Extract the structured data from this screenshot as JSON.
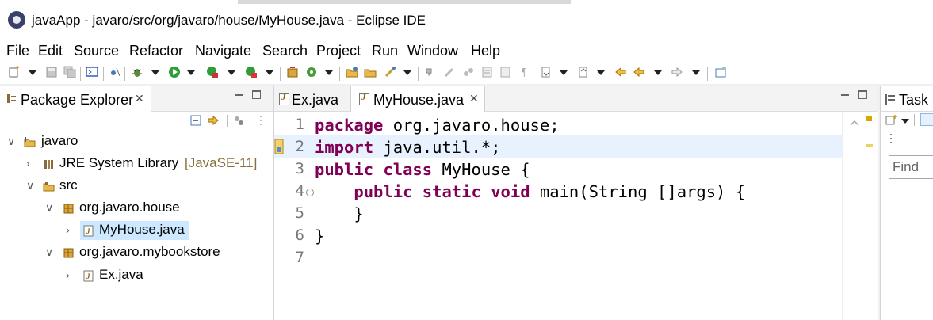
{
  "window": {
    "title": "javaApp - javaro/src/org/javaro/house/MyHouse.java - Eclipse IDE"
  },
  "menu": {
    "items": [
      "File",
      "Edit",
      "Source",
      "Refactor",
      "Navigate",
      "Search",
      "Project",
      "Run",
      "Window",
      "Help"
    ]
  },
  "toolbar": {
    "icons": [
      "new-icon",
      "save-icon",
      "save-all-icon",
      "terminal-icon",
      "skip-breakpoints-icon",
      "debug-icon",
      "run-icon",
      "coverage-icon",
      "external-tools-icon",
      "new-java-project-icon",
      "new-package-icon",
      "new-class-icon",
      "open-type-icon",
      "open-task-icon",
      "search-icon",
      "toggle-mark-occurrences-icon",
      "toggle-block-selection-icon",
      "show-whitespace-icon",
      "next-annotation-icon",
      "previous-annotation-icon",
      "last-edit-location-icon",
      "back-icon",
      "forward-icon",
      "pin-editor-icon"
    ]
  },
  "package_explorer": {
    "tab_label": "Package Explorer",
    "close_glyph": "✕",
    "tree": [
      {
        "label": "javaro",
        "decor": "",
        "level": 0,
        "twisty": "expanded",
        "icon": "project-icon"
      },
      {
        "label": "JRE System Library",
        "decor": "[JavaSE-11]",
        "level": 1,
        "twisty": "collapsed",
        "icon": "library-icon"
      },
      {
        "label": "src",
        "decor": "",
        "level": 1,
        "twisty": "expanded",
        "icon": "source-folder-icon"
      },
      {
        "label": "org.javaro.house",
        "decor": "",
        "level": 2,
        "twisty": "expanded",
        "icon": "package-icon"
      },
      {
        "label": "MyHouse.java",
        "decor": "",
        "level": 3,
        "twisty": "collapsed",
        "icon": "java-file-icon",
        "selected": true
      },
      {
        "label": "org.javaro.mybookstore",
        "decor": "",
        "level": 2,
        "twisty": "expanded",
        "icon": "package-icon"
      },
      {
        "label": "Ex.java",
        "decor": "",
        "level": 3,
        "twisty": "collapsed",
        "icon": "java-file-icon"
      }
    ]
  },
  "editor": {
    "tabs": [
      {
        "label": "Ex.java",
        "active": false
      },
      {
        "label": "MyHouse.java",
        "active": true,
        "close_glyph": "✕"
      }
    ],
    "lines": [
      {
        "num": "1",
        "code": "package org.javaro.house;"
      },
      {
        "num": "2",
        "code": "import java.util.*;"
      },
      {
        "num": "3",
        "code": "public class MyHouse {"
      },
      {
        "num": "4",
        "code": "    public static void main(String []args) {"
      },
      {
        "num": "5",
        "code": "    }"
      },
      {
        "num": "6",
        "code": "}"
      },
      {
        "num": "7",
        "code": ""
      }
    ]
  },
  "task_panel": {
    "tab_label": "Task",
    "find_placeholder": "Find"
  },
  "colors": {
    "keyword": "#7f0055",
    "selection": "#cde8ff",
    "current_line": "#e8f2fe"
  }
}
